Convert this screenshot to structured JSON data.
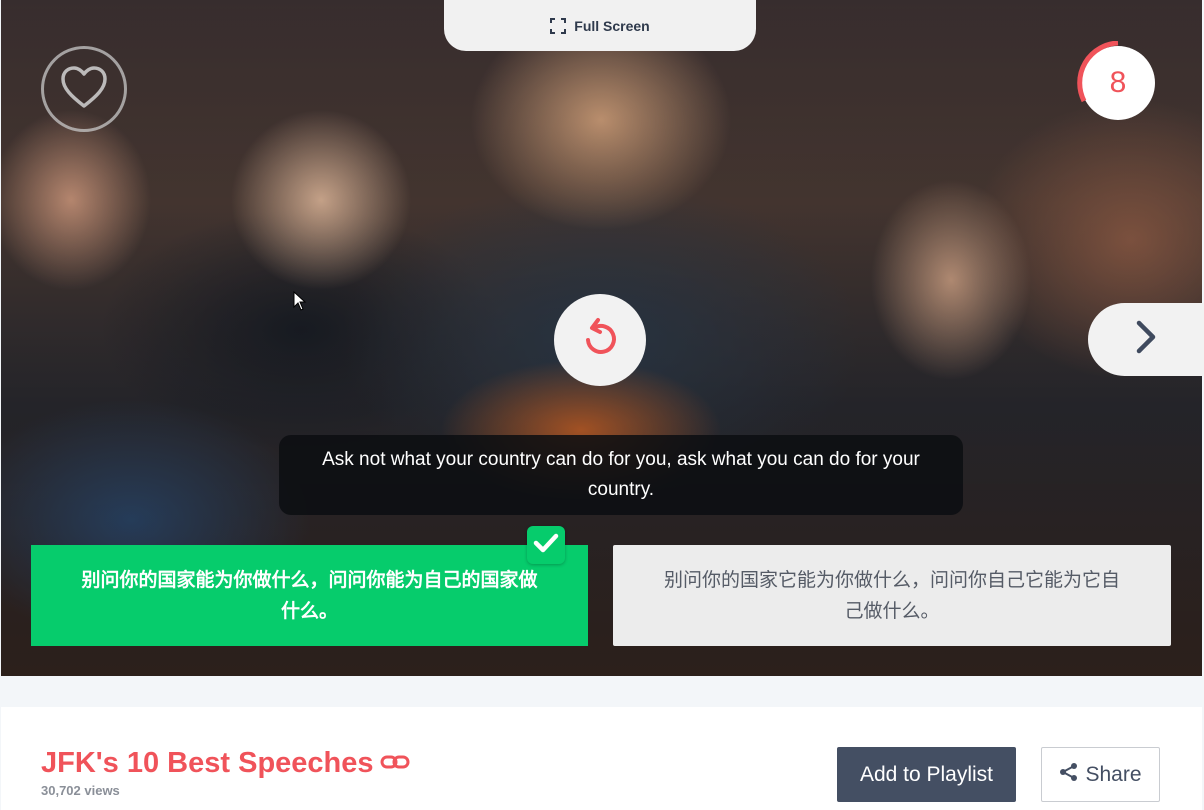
{
  "player": {
    "fullscreen_label": "Full Screen",
    "timer_value": "8",
    "subtitle_en": "Ask not what your country can do for you, ask what you can do for your country.",
    "answers": [
      {
        "text": "别问你的国家能为你做什么，问问你能为自己的国家做什么。",
        "state": "correct"
      },
      {
        "text": "别问你的国家它能为你做什么，问问你自己它能为它自己做什么。",
        "state": "unselected"
      }
    ],
    "icons": {
      "fullscreen": "fullscreen-icon",
      "favorite": "heart-icon",
      "replay": "replay-icon",
      "next": "chevron-right-icon",
      "correct": "check-icon"
    },
    "colors": {
      "accent": "#f0535a",
      "correct": "#06cc6c",
      "dark_button": "#444f63"
    }
  },
  "video_info": {
    "title": "JFK's 10 Best Speeches",
    "views": "30,702 views",
    "add_to_playlist_label": "Add to Playlist",
    "share_label": "Share",
    "icons": {
      "link": "link-icon",
      "share": "share-icon"
    }
  }
}
